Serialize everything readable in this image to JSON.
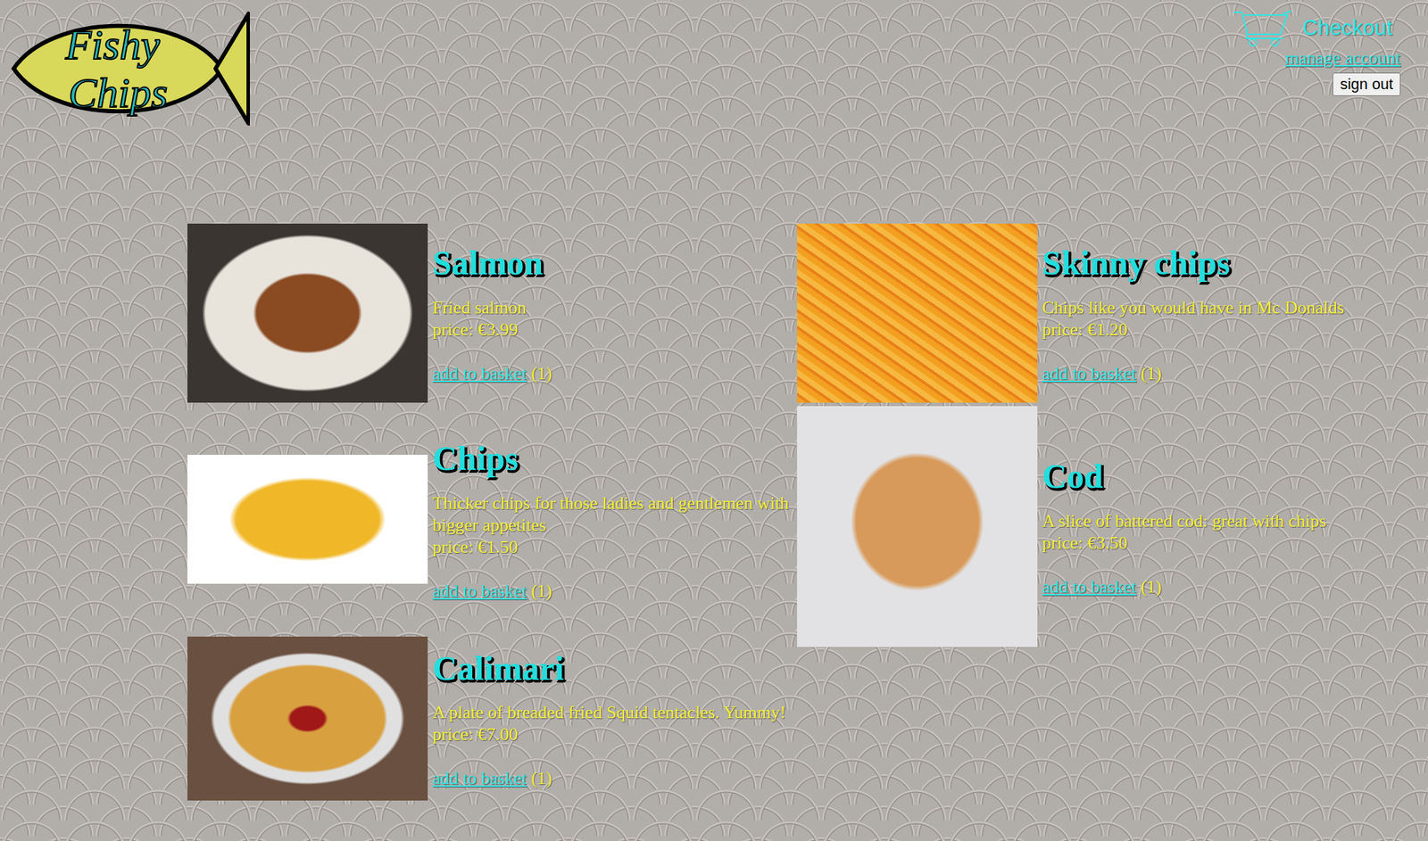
{
  "header": {
    "logo": {
      "line1": "Fishy",
      "line2": "Chips"
    },
    "checkout": "Checkout",
    "manage_account": "manage account",
    "sign_out": "sign out"
  },
  "columns": [
    {
      "items": [
        {
          "name": "Salmon",
          "description": "Fried salmon",
          "price": "price: €3.99",
          "add_label": "add to basket",
          "quantity": "(1)"
        },
        {
          "name": "Chips",
          "description": "Thicker chips for those ladies and gentlemen with bigger appetites",
          "price": "price: €1.50",
          "add_label": "add to basket",
          "quantity": "(1)"
        },
        {
          "name": "Calimari",
          "description": "A plate of breaded fried Squid tentacles. Yummy!",
          "price": "price: €7.00",
          "add_label": "add to basket",
          "quantity": "(1)"
        }
      ]
    },
    {
      "items": [
        {
          "name": "Skinny chips",
          "description": "Chips like you would have in Mc Donalds",
          "price": "price: €1.20",
          "add_label": "add to basket",
          "quantity": "(1)"
        },
        {
          "name": "Cod",
          "description": "A slice of battered cod: great with chips",
          "price": "price: €3.50",
          "add_label": "add to basket",
          "quantity": "(1)"
        }
      ]
    }
  ]
}
